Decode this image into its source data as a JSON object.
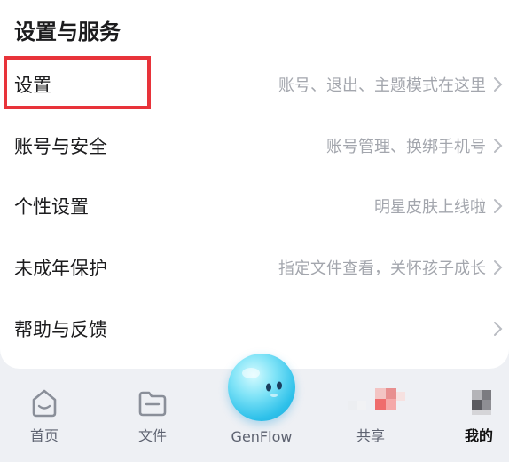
{
  "section": {
    "title": "设置与服务"
  },
  "rows": [
    {
      "label": "设置",
      "desc": "账号、退出、主题模式在这里"
    },
    {
      "label": "账号与安全",
      "desc": "账号管理、换绑手机号"
    },
    {
      "label": "个性设置",
      "desc": "明星皮肤上线啦"
    },
    {
      "label": "未成年保护",
      "desc": "指定文件查看，关怀孩子成长"
    },
    {
      "label": "帮助与反馈",
      "desc": ""
    }
  ],
  "tabs": {
    "home": "首页",
    "files": "文件",
    "genflow": "GenFlow",
    "share": "共享",
    "mine": "我的"
  },
  "colors": {
    "highlight": "#e8333a",
    "text_primary": "#1c1c1e",
    "text_secondary": "#a3a6ad",
    "genflow": "#2fc1ea"
  }
}
